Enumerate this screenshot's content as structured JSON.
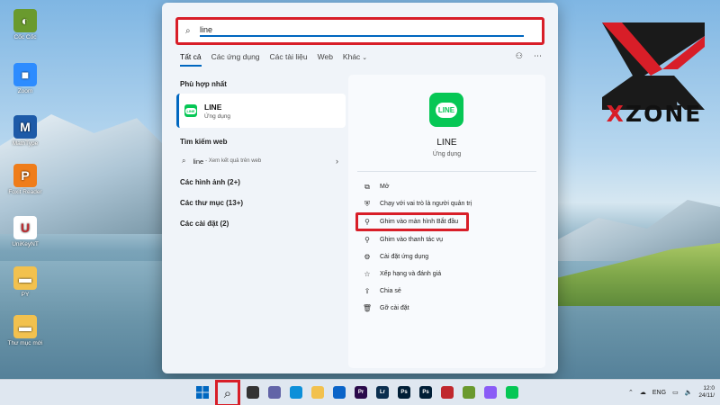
{
  "desktop": {
    "icons": [
      {
        "label": "Cốc Cốc",
        "color": "#6a9a2e",
        "glyph": "◐"
      },
      {
        "label": "Zoom",
        "color": "#2d8cff",
        "glyph": "■"
      },
      {
        "label": "MathType",
        "color": "#1d5aa8",
        "glyph": "M"
      },
      {
        "label": "Foxit Reader",
        "color": "#ef7d1a",
        "glyph": "P"
      },
      {
        "label": "UniKeyNT",
        "color": "#ffffff",
        "glyph": "U"
      },
      {
        "label": "PY",
        "color": "#f2c14e",
        "glyph": "▬"
      },
      {
        "label": "Thư mục mới",
        "color": "#f2c14e",
        "glyph": "▬"
      }
    ]
  },
  "search": {
    "query": "line",
    "tabs": [
      "Tất cả",
      "Các ứng dụng",
      "Các tài liệu",
      "Web",
      "Khác"
    ],
    "more_chevron": "⌄",
    "best_match_title": "Phù hợp nhất",
    "best_match": {
      "name": "LINE",
      "type": "Ứng dụng"
    },
    "web_title": "Tìm kiếm web",
    "web_query": "line",
    "web_hint": "- Xem kết quả trên web",
    "categories": [
      "Các hình ảnh (2+)",
      "Các thư mục (13+)",
      "Các cài đặt (2)"
    ]
  },
  "preview": {
    "app_name": "LINE",
    "app_type": "Ứng dụng",
    "icon_text": "LINE",
    "actions": [
      {
        "label": "Mở",
        "icon": "open-icon"
      },
      {
        "label": "Chạy với vai trò là người quản trị",
        "icon": "shield-icon"
      },
      {
        "label": "Ghim vào màn hình Bắt đầu",
        "icon": "pin-icon"
      },
      {
        "label": "Ghim vào thanh tác vụ",
        "icon": "pin-icon"
      },
      {
        "label": "Cài đặt ứng dụng",
        "icon": "gear-icon"
      },
      {
        "label": "Xếp hạng và đánh giá",
        "icon": "star-icon"
      },
      {
        "label": "Chia sẻ",
        "icon": "share-icon"
      },
      {
        "label": "Gỡ cài đặt",
        "icon": "trash-icon"
      }
    ]
  },
  "logo": {
    "text_prefix": "X",
    "text_rest": "ZONE"
  },
  "taskbar": {
    "icons": [
      {
        "name": "start-icon",
        "color": "#0067c0",
        "label": ""
      },
      {
        "name": "search-icon",
        "color": "",
        "label": ""
      },
      {
        "name": "task-view-icon",
        "color": "#333333",
        "label": ""
      },
      {
        "name": "teams-icon",
        "color": "#6264a7",
        "label": ""
      },
      {
        "name": "edge-icon",
        "color": "#0c8fd9",
        "label": ""
      },
      {
        "name": "file-explorer-icon",
        "color": "#f2c14e",
        "label": ""
      },
      {
        "name": "mail-icon",
        "color": "#0a64c8",
        "label": ""
      },
      {
        "name": "premiere-icon",
        "color": "#2a0a4a",
        "label": "Pr"
      },
      {
        "name": "lightroom-icon",
        "color": "#0b2f4f",
        "label": "Lr"
      },
      {
        "name": "photoshop-icon",
        "color": "#001e36",
        "label": "Ps"
      },
      {
        "name": "photoshop-icon-2",
        "color": "#001e36",
        "label": "Ps"
      },
      {
        "name": "app-icon-red",
        "color": "#c0282d",
        "label": ""
      },
      {
        "name": "coccoc-icon",
        "color": "#6a9a2e",
        "label": ""
      },
      {
        "name": "messenger-icon",
        "color": "#8a5cf6",
        "label": ""
      },
      {
        "name": "line-icon",
        "color": "#06c755",
        "label": ""
      }
    ],
    "tray_lang": "ENG",
    "time": "12:0",
    "date": "24/11/"
  },
  "colors": {
    "accent": "#0067c0",
    "highlight": "#d81e28",
    "line_green": "#06c755"
  }
}
